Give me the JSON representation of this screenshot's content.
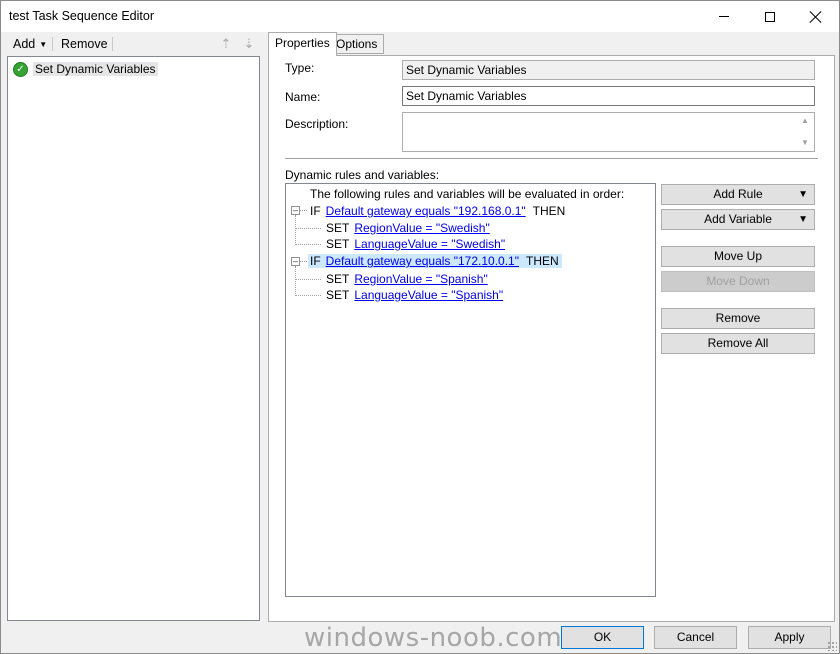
{
  "window": {
    "title": "test Task Sequence Editor"
  },
  "toolbar": {
    "add_label": "Add",
    "remove_label": "Remove"
  },
  "tree": {
    "items": [
      {
        "label": "Set Dynamic Variables",
        "status_icon": "check-icon"
      }
    ]
  },
  "tabs": [
    {
      "label": "Properties",
      "active": true
    },
    {
      "label": "Options",
      "active": false
    }
  ],
  "properties": {
    "type_label": "Type:",
    "type_value": "Set Dynamic Variables",
    "name_label": "Name:",
    "name_value": "Set Dynamic Variables",
    "description_label": "Description:",
    "description_value": "",
    "rules_label": "Dynamic rules and variables:",
    "rules_header": "The following rules and variables will be evaluated in order:"
  },
  "rules": [
    {
      "keyword": "IF",
      "condition": "Default gateway equals \"192.168.0.1\"",
      "then": "THEN",
      "selected": false,
      "sets": [
        {
          "keyword": "SET",
          "text": "RegionValue = \"Swedish\""
        },
        {
          "keyword": "SET",
          "text": "LanguageValue = \"Swedish\""
        }
      ]
    },
    {
      "keyword": "IF",
      "condition": "Default gateway equals \"172.10.0.1\"",
      "then": "THEN",
      "selected": true,
      "sets": [
        {
          "keyword": "SET",
          "text": "RegionValue = \"Spanish\""
        },
        {
          "keyword": "SET",
          "text": "LanguageValue = \"Spanish\""
        }
      ]
    }
  ],
  "side_buttons": {
    "add_rule": "Add Rule",
    "add_variable": "Add Variable",
    "move_up": "Move Up",
    "move_down": "Move Down",
    "remove": "Remove",
    "remove_all": "Remove All"
  },
  "dialog_buttons": {
    "ok": "OK",
    "cancel": "Cancel",
    "apply": "Apply"
  },
  "watermark": "windows-noob.com",
  "colors": {
    "selection": "#cce8ff",
    "link": "#0000ee",
    "status_ok": "#34a334"
  }
}
